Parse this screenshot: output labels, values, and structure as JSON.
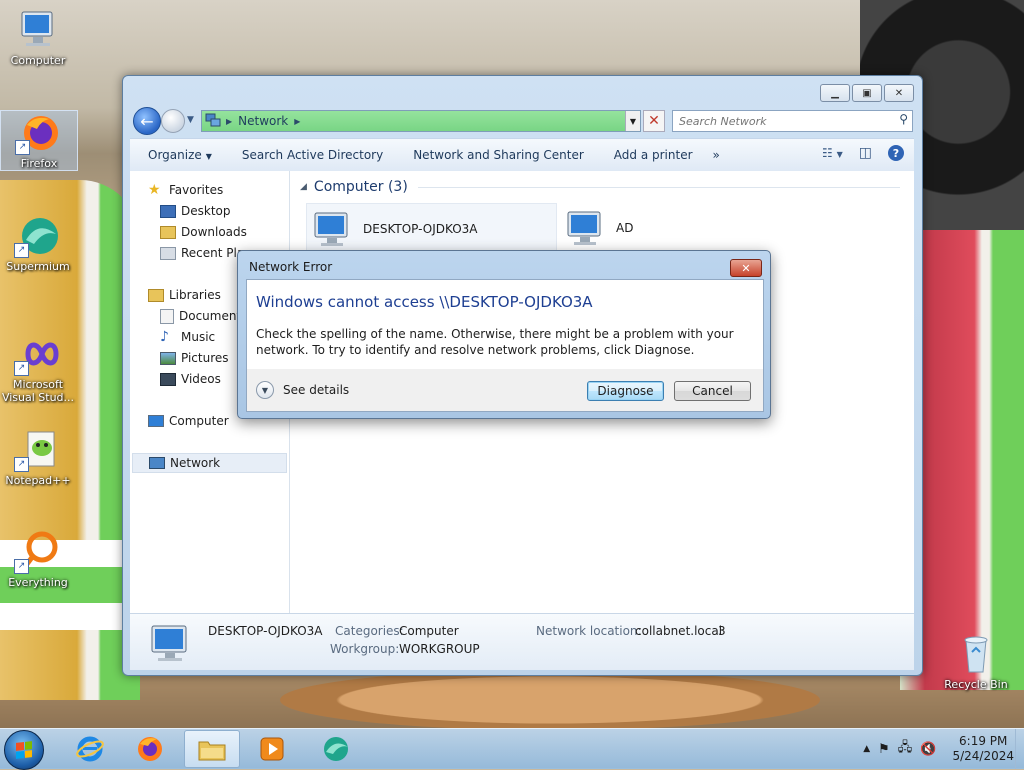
{
  "desktop": {
    "icons": [
      {
        "label": "Computer"
      },
      {
        "label": "Firefox"
      },
      {
        "label": "Supermium"
      },
      {
        "label": "Microsoft Visual Stud..."
      },
      {
        "label": "Notepad++"
      },
      {
        "label": "Everything"
      },
      {
        "label": "Recycle Bin"
      }
    ]
  },
  "explorer": {
    "address_crumb": "Network",
    "search_placeholder": "Search Network",
    "commands": {
      "organize": "Organize",
      "search_ad": "Search Active Directory",
      "network_sharing": "Network and Sharing Center",
      "add_printer": "Add a printer",
      "more": "»"
    },
    "nav": {
      "favorites": "Favorites",
      "desktop": "Desktop",
      "downloads": "Downloads",
      "recent": "Recent Pla",
      "libraries": "Libraries",
      "documents": "Document",
      "music": "Music",
      "pictures": "Pictures",
      "videos": "Videos",
      "computer": "Computer",
      "network": "Network"
    },
    "group_header": "Computer (3)",
    "items": [
      {
        "name": "DESKTOP-OJDKO3A"
      },
      {
        "name": "AD"
      }
    ],
    "details": {
      "name": "DESKTOP-OJDKO3A",
      "categories_label": "Categories:",
      "categories_value": "Computer",
      "workgroup_label": "Workgroup:",
      "workgroup_value": "WORKGROUP",
      "location_label": "Network location:",
      "location_value": "collabnet.local",
      "location_suffix": "3"
    }
  },
  "dialog": {
    "title": "Network Error",
    "main_instruction": "Windows cannot access \\\\DESKTOP-OJDKO3A",
    "content": "Check the spelling of the name. Otherwise, there might be a problem with your network. To try to identify and resolve network problems, click Diagnose.",
    "see_details": "See details",
    "diagnose": "Diagnose",
    "cancel": "Cancel"
  },
  "taskbar": {
    "time": "6:19 PM",
    "date": "5/24/2024"
  },
  "colors": {
    "address_green": "#79d585",
    "dialog_instruction": "#1e3f92",
    "close_red": "#c7432b"
  }
}
